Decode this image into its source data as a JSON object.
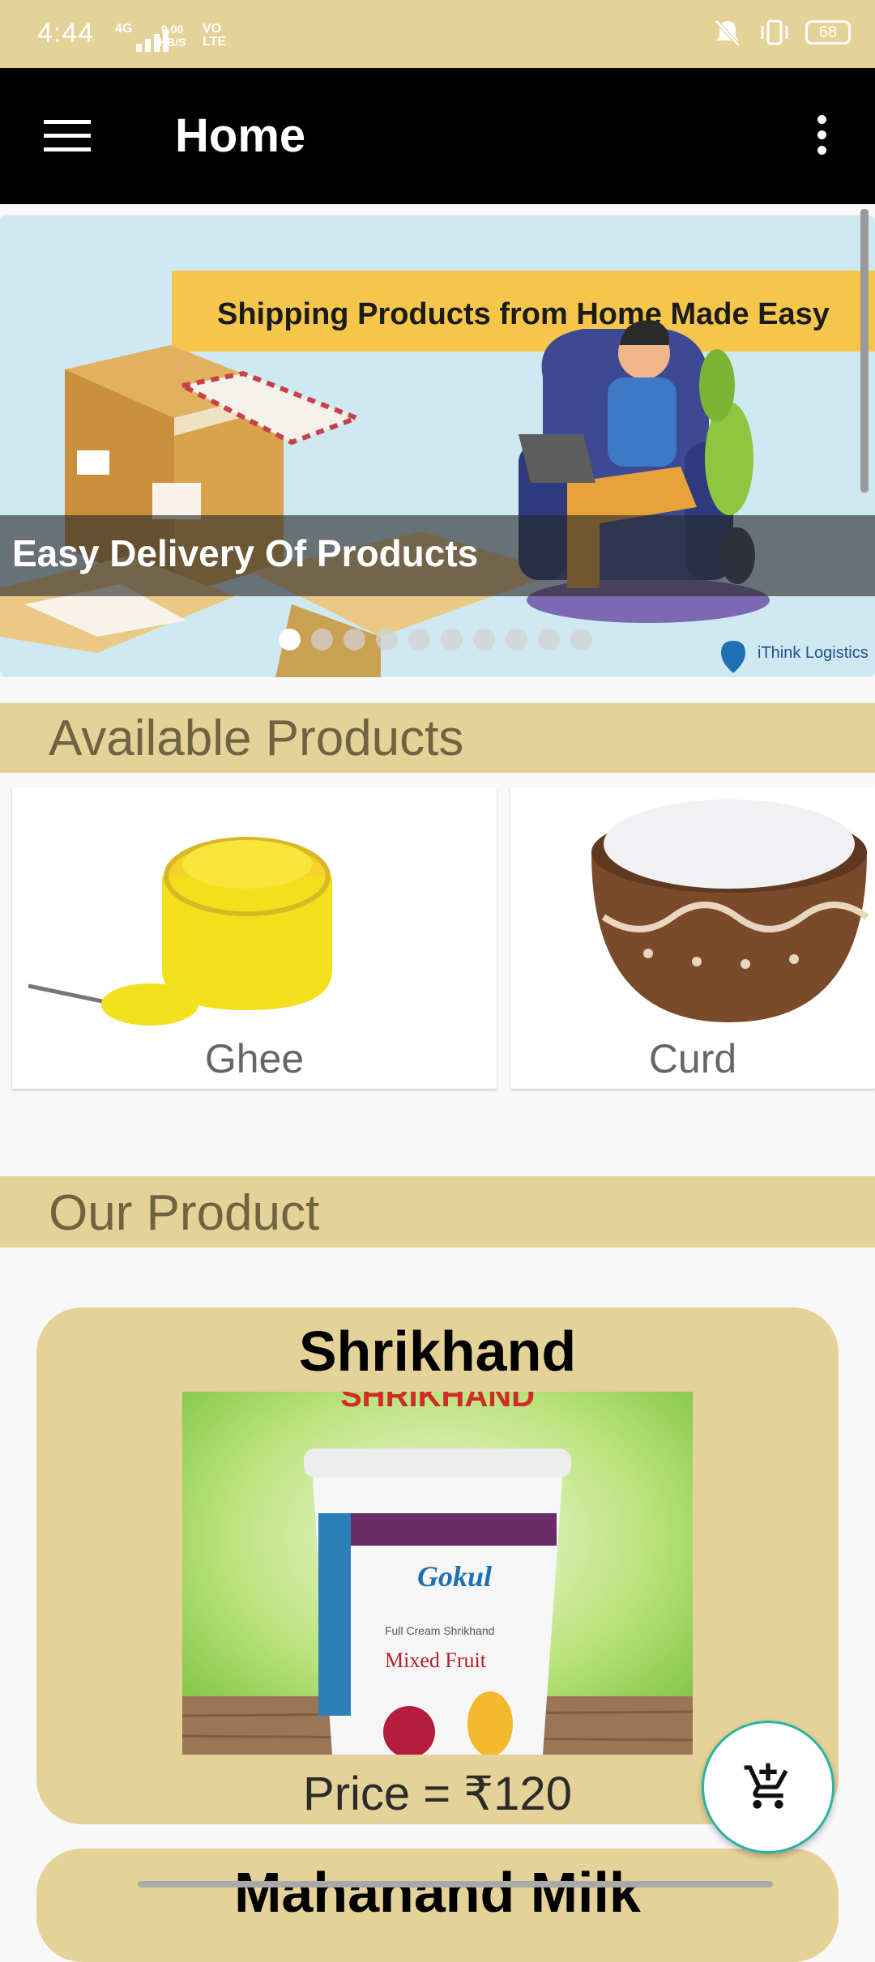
{
  "status_bar": {
    "time": "4:44",
    "network": "4G",
    "speed_value": "0.00",
    "speed_unit": "KB/S",
    "volte_top": "VO",
    "volte_bottom": "LTE",
    "battery": "68"
  },
  "app_bar": {
    "title": "Home",
    "menu_icon": "hamburger-menu-icon",
    "more_icon": "more-vertical-icon"
  },
  "banner": {
    "headline": "Shipping Products from Home Made Easy",
    "caption": "Easy Delivery Of Products",
    "brand": "iThink Logistics",
    "slide_count": 10,
    "active_slide": 1
  },
  "available_products": {
    "title": "Available Products",
    "items": [
      {
        "label": "Ghee"
      },
      {
        "label": "Curd"
      }
    ]
  },
  "our_product": {
    "title": "Our Product",
    "items": [
      {
        "name": "Shrikhand",
        "price_label": "Price =  ₹120",
        "image_banner": "SHRIKHAND",
        "image_brand": "Gokul",
        "image_sub1": "Full Cream Shrikhand",
        "image_sub2": "Mixed Fruit"
      },
      {
        "name": "Mahanand Milk"
      }
    ]
  },
  "cart_fab": {
    "icon": "add-shopping-cart-icon"
  },
  "colors": {
    "accent": "#e5d298",
    "app_bar": "#000000",
    "fab_border": "#2bb3a3"
  }
}
